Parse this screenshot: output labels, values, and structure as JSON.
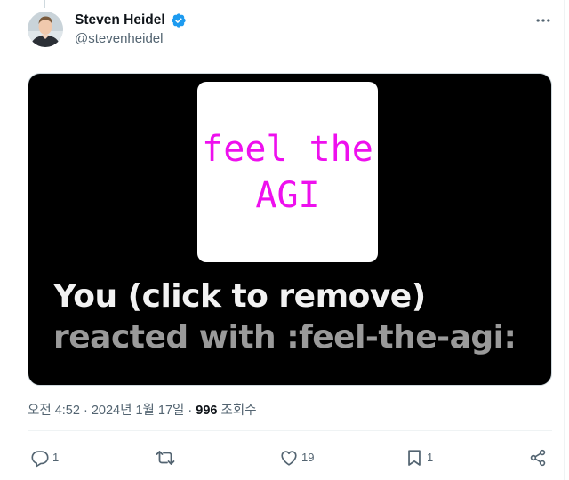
{
  "tweet": {
    "author": {
      "name": "Steven Heidel",
      "handle": "@stevenheidel",
      "verified": true
    },
    "media": {
      "emoji_text_line1": "feel the",
      "emoji_text_line2": "AGI",
      "reaction_you": "You (click to remove)",
      "reaction_rest": " reacted with :feel-the-agi:"
    },
    "meta": {
      "time": "오전 4:52",
      "separator": "·",
      "date": "2024년 1월 17일",
      "views_count": "996",
      "views_label": " 조회수"
    },
    "actions": {
      "reply_count": "1",
      "retweet_count": "",
      "like_count": "19",
      "bookmark_count": "1"
    }
  },
  "colors": {
    "accent_verified": "#1d9bf0",
    "emoji_magenta": "#ee10ee",
    "muted_text": "#536471"
  }
}
